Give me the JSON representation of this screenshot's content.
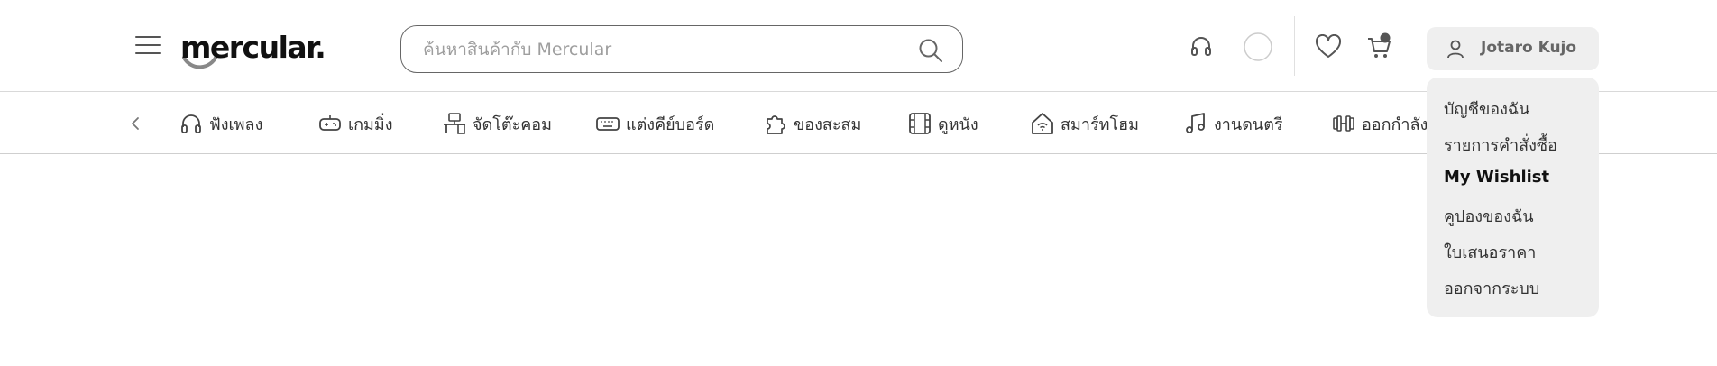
{
  "header": {
    "menu_icon": "hamburger-menu-icon",
    "logo_text": "mercular.",
    "search": {
      "placeholder": "ค้นหาสินค้ากับ Mercular",
      "value": ""
    },
    "icons": [
      "headphones-support-icon",
      "theme-toggle-icon",
      "wishlist-heart-icon",
      "cart-icon"
    ],
    "cart_has_badge": true,
    "user": {
      "name": "Jotaro Kujo",
      "icon": "user-icon"
    }
  },
  "categories": {
    "prev_icon": "chevron-left-icon",
    "items": [
      {
        "label": "ฟังเพลง",
        "icon": "headphones-icon"
      },
      {
        "label": "เกมมิ่ง",
        "icon": "gamepad-icon"
      },
      {
        "label": "จัดโต๊ะคอม",
        "icon": "desk-icon"
      },
      {
        "label": "แต่งคีย์บอร์ด",
        "icon": "keyboard-icon"
      },
      {
        "label": "ของสะสม",
        "icon": "puzzle-icon"
      },
      {
        "label": "ดูหนัง",
        "icon": "film-icon"
      },
      {
        "label": "สมาร์ทโฮม",
        "icon": "smart-home-icon"
      },
      {
        "label": "งานดนตรี",
        "icon": "music-note-icon"
      },
      {
        "label": "ออกกำลัง",
        "icon": "dumbbell-icon"
      }
    ]
  },
  "user_menu": {
    "items": [
      {
        "label": "บัญชีของฉัน",
        "active": false
      },
      {
        "label": "รายการคำสั่งซื้อ",
        "active": false
      },
      {
        "label": "My Wishlist",
        "active": true
      },
      {
        "label": "คูปองของฉัน",
        "active": false
      },
      {
        "label": "ใบเสนอราคา",
        "active": false
      },
      {
        "label": "ออกจากระบบ",
        "active": false
      }
    ]
  },
  "colors": {
    "dropdown_bg": "#efefef",
    "border": "#d9d9d9",
    "text": "#333333"
  }
}
